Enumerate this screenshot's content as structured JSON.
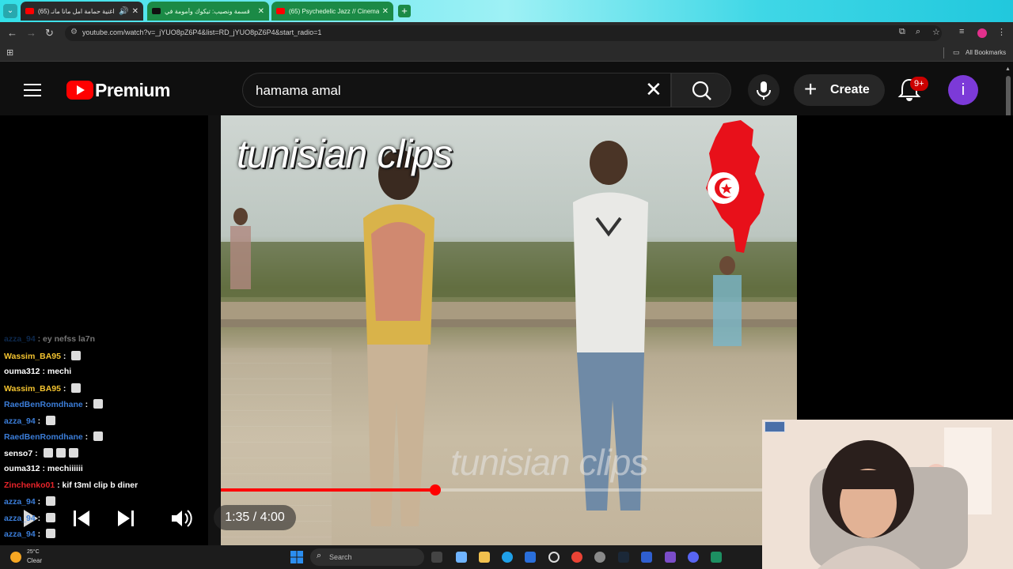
{
  "browser": {
    "tabs": [
      {
        "title": "اغنية حمامة امل مانا مانـ (65)",
        "muted": true
      },
      {
        "title": "قسمة ونصيب: تيكوك وأمومة في",
        "muted": false
      },
      {
        "title": "(65) Psychedelic Jazz // Cinema",
        "muted": false
      }
    ],
    "url": "youtube.com/watch?v=_jYUO8pZ6P4&list=RD_jYUO8pZ6P4&start_radio=1",
    "bookmarks_label": "All Bookmarks"
  },
  "youtube": {
    "brand": "Premium",
    "search_value": "hamama amal",
    "create_label": "Create",
    "notification_count": "9+",
    "avatar_letter": "i"
  },
  "video": {
    "watermark_top": "tunisian clips",
    "watermark_bottom": "tunisian clips",
    "time": "1:35 / 4:00",
    "progress_fraction": 0.3958
  },
  "chat": [
    {
      "user": "azza_94",
      "text": "ey nefss la7n",
      "color": "#1e5aa8",
      "emotes": 0,
      "faded": true
    },
    {
      "user": "Wassim_BA95",
      "text": "",
      "color": "#f4c430",
      "emotes": 1
    },
    {
      "user": "ouma312",
      "text": "mechi",
      "color": "#ffffff",
      "emotes": 0
    },
    {
      "user": "Wassim_BA95",
      "text": "",
      "color": "#f4c430",
      "emotes": 1
    },
    {
      "user": "RaedBenRomdhane",
      "text": "",
      "color": "#3b7dd8",
      "emotes": 1
    },
    {
      "user": "azza_94",
      "text": "",
      "color": "#3b7dd8",
      "emotes": 1
    },
    {
      "user": "RaedBenRomdhane",
      "text": "",
      "color": "#3b7dd8",
      "emotes": 1
    },
    {
      "user": "senso7",
      "text": "",
      "color": "#ffffff",
      "emotes": 3
    },
    {
      "user": "ouma312",
      "text": "mechiiiiii",
      "color": "#ffffff",
      "emotes": 0
    },
    {
      "user": "Zinchenko01",
      "text": "kif t3ml clip b diner",
      "color": "#e8242a",
      "emotes": 0
    },
    {
      "user": "azza_94",
      "text": "",
      "color": "#3b7dd8",
      "emotes": 1
    },
    {
      "user": "azza_94",
      "text": "",
      "color": "#3b7dd8",
      "emotes": 1
    },
    {
      "user": "azza_94",
      "text": "",
      "color": "#3b7dd8",
      "emotes": 1
    }
  ],
  "taskbar": {
    "temperature": "25°C",
    "condition": "Clear",
    "search_placeholder": "Search"
  },
  "icons": [
    "menu-icon",
    "search-icon",
    "mic-icon",
    "bell-icon",
    "play-icon",
    "skip-previous-icon",
    "skip-next-icon",
    "volume-icon",
    "windows-start-icon"
  ]
}
